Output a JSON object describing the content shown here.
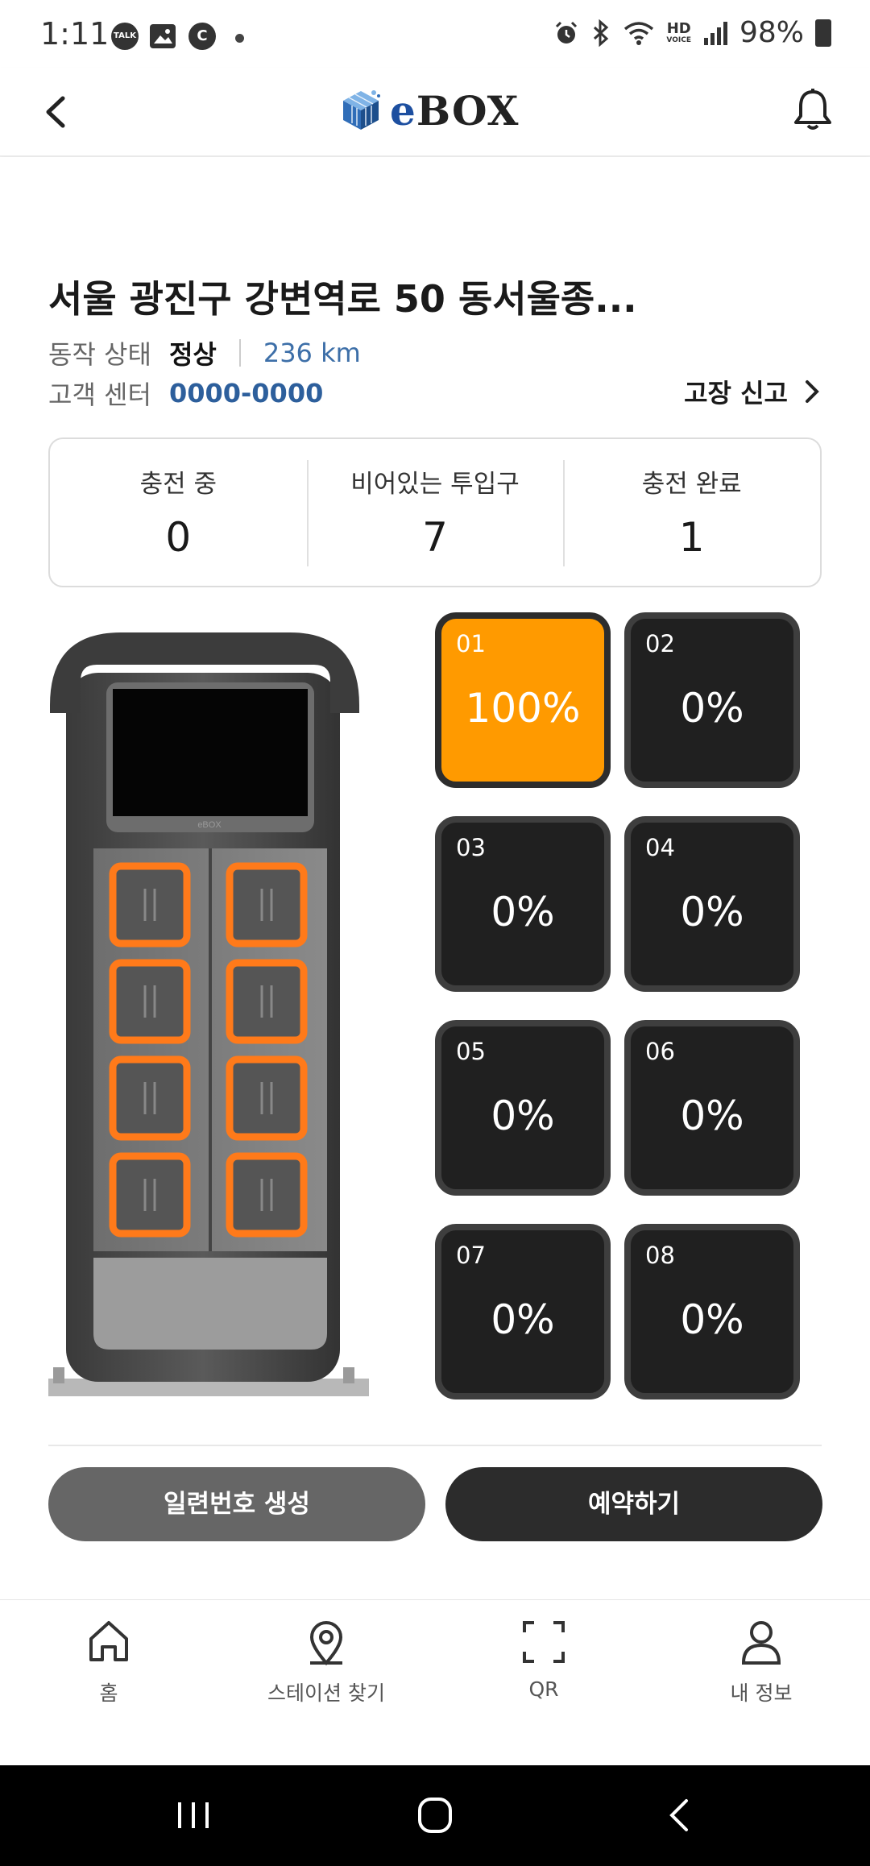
{
  "status_bar": {
    "time": "1:11",
    "icons_left": [
      "talk-icon",
      "gallery-icon",
      "c-icon",
      "dot"
    ],
    "talk_label": "TALK",
    "c_label": "C",
    "icons_right": [
      "alarm-icon",
      "bluetooth-icon",
      "wifi-icon",
      "hd-voice-icon",
      "signal-icon",
      "battery-icon"
    ],
    "hd_label": "HD",
    "voice_label": "VOICE",
    "battery": "98%"
  },
  "header": {
    "logo_text_e": "e",
    "logo_text_rest": "BOX",
    "back_icon": "chevron-left-icon",
    "bell_icon": "bell-icon"
  },
  "station": {
    "address": "서울 광진구 강변역로 50 동서울종...",
    "status_label": "동작 상태",
    "status_value": "정상",
    "distance": "236 km",
    "support_label": "고객 센터",
    "support_phone": "0000-0000",
    "report_label": "고장 신고",
    "kiosk_brand": "eBOX"
  },
  "stats": [
    {
      "label": "충전 중",
      "value": "0"
    },
    {
      "label": "비어있는 투입구",
      "value": "7"
    },
    {
      "label": "충전 완료",
      "value": "1"
    }
  ],
  "slots": [
    {
      "number": "01",
      "percent": "100%",
      "state": "full"
    },
    {
      "number": "02",
      "percent": "0%",
      "state": "empty"
    },
    {
      "number": "03",
      "percent": "0%",
      "state": "empty"
    },
    {
      "number": "04",
      "percent": "0%",
      "state": "empty"
    },
    {
      "number": "05",
      "percent": "0%",
      "state": "empty"
    },
    {
      "number": "06",
      "percent": "0%",
      "state": "empty"
    },
    {
      "number": "07",
      "percent": "0%",
      "state": "empty"
    },
    {
      "number": "08",
      "percent": "0%",
      "state": "empty"
    }
  ],
  "actions": {
    "serial_label": "일련번호 생성",
    "reserve_label": "예약하기"
  },
  "bottom_nav": [
    {
      "label": "홈",
      "icon": "home-icon"
    },
    {
      "label": "스테이션 찾기",
      "icon": "map-pin-icon"
    },
    {
      "label": "QR",
      "icon": "qr-scan-icon"
    },
    {
      "label": "내 정보",
      "icon": "user-icon"
    }
  ],
  "colors": {
    "accent_orange": "#ff9a00",
    "slot_dark": "#202020",
    "link_blue": "#2d5f9c"
  }
}
